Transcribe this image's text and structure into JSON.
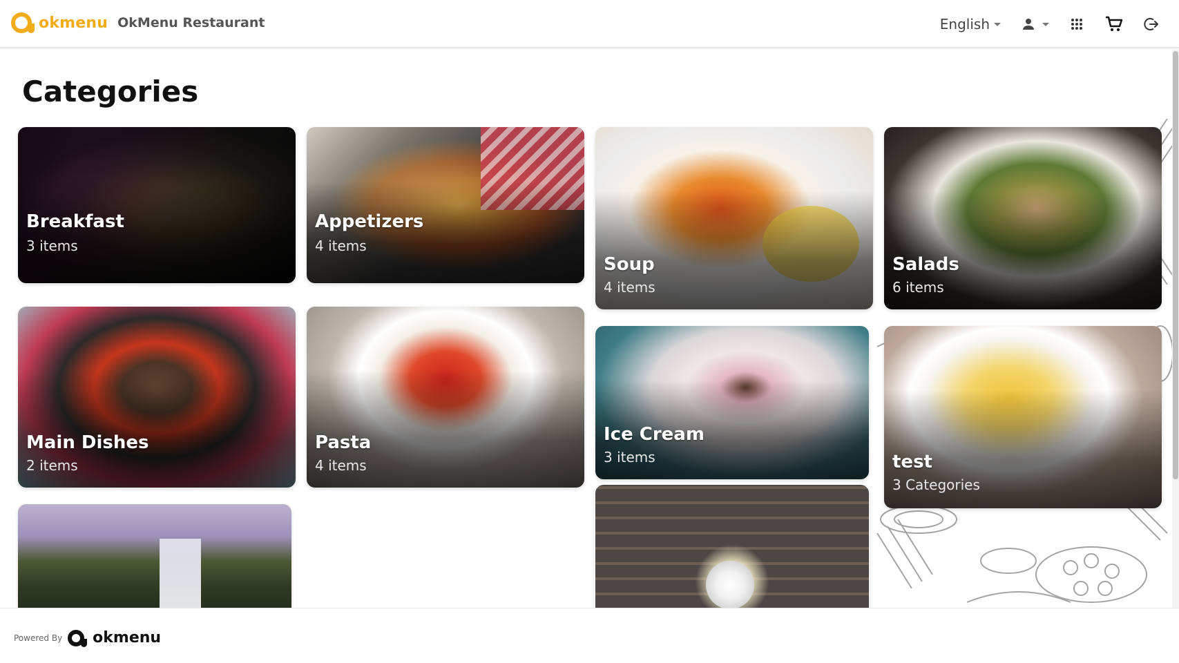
{
  "header": {
    "brand": "okmenu",
    "restaurant": "OkMenu Restaurant",
    "language": "English"
  },
  "page": {
    "title": "Categories"
  },
  "categories": [
    {
      "title": "Breakfast",
      "count": "3 items"
    },
    {
      "title": "Appetizers",
      "count": "4 items"
    },
    {
      "title": "Soup",
      "count": "4 items"
    },
    {
      "title": "Salads",
      "count": "6 items"
    },
    {
      "title": "Main Dishes",
      "count": "2 items"
    },
    {
      "title": "Pasta",
      "count": "4 items"
    },
    {
      "title": "Ice Cream",
      "count": "3 items"
    },
    {
      "title": "test",
      "count": "3 Categories"
    }
  ],
  "footer": {
    "powered_by": "Powered By",
    "brand": "okmenu"
  },
  "colors": {
    "accent": "#f2ac1a",
    "text": "#111111",
    "muted": "#555555"
  },
  "icons": [
    "user-icon",
    "apps-grid-icon",
    "cart-icon",
    "logout-icon"
  ]
}
